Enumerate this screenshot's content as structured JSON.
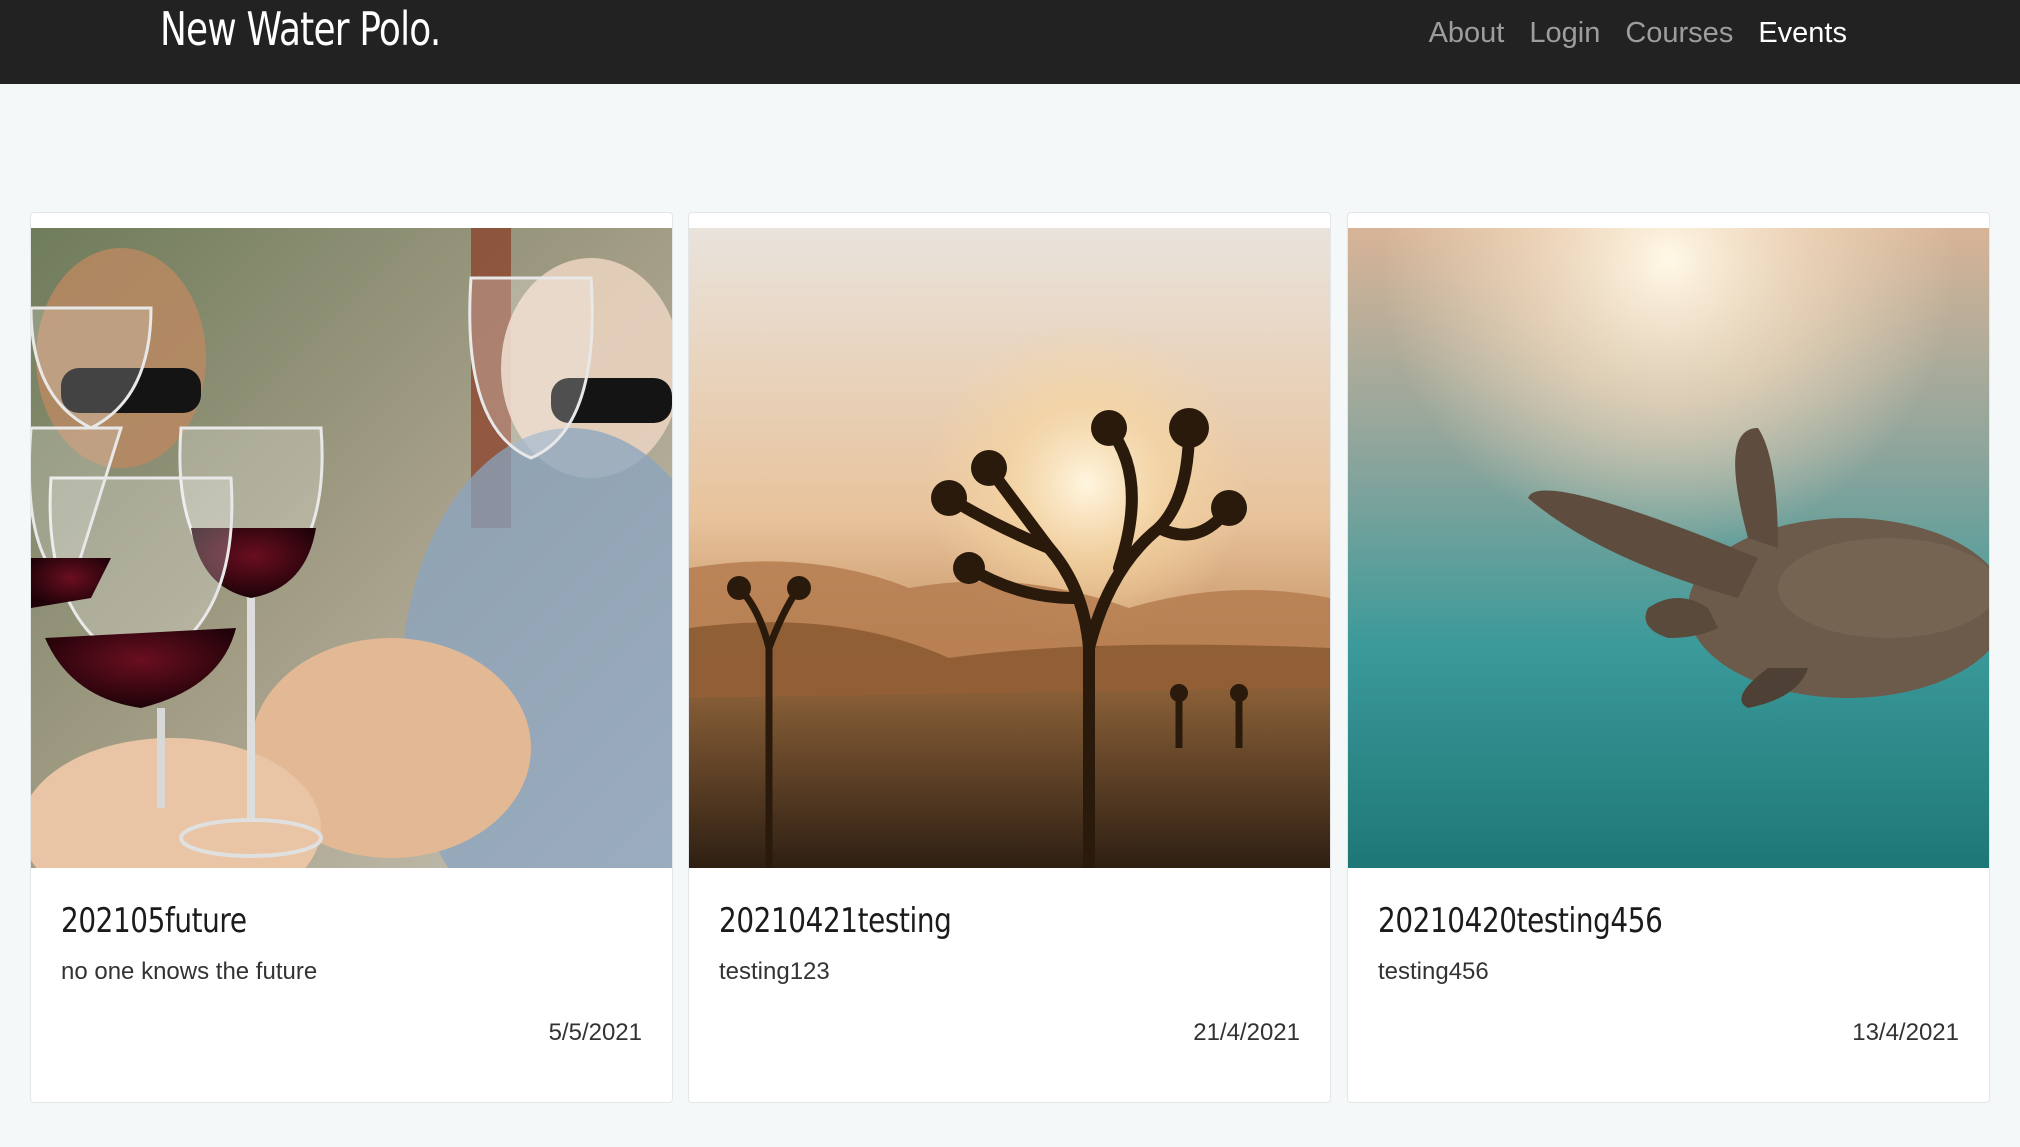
{
  "navbar": {
    "brand": "New Water Polo.",
    "links": [
      {
        "label": "About",
        "active": false
      },
      {
        "label": "Login",
        "active": false
      },
      {
        "label": "Courses",
        "active": false
      },
      {
        "label": "Events",
        "active": true
      }
    ]
  },
  "events": [
    {
      "title": "202105future",
      "description": "no one knows the future",
      "date": "5/5/2021",
      "image": "wine-glasses-photo"
    },
    {
      "title": "20210421testing",
      "description": "testing123",
      "date": "21/4/2021",
      "image": "joshua-tree-sunset-photo"
    },
    {
      "title": "20210420testing456",
      "description": "testing456",
      "date": "13/4/2021",
      "image": "sea-turtle-underwater-photo"
    }
  ],
  "colors": {
    "navbar_bg": "#222222",
    "nav_link": "#9d9d9d",
    "nav_link_active": "#ffffff",
    "page_bg": "#f5f8f9",
    "card_bg": "#ffffff"
  }
}
